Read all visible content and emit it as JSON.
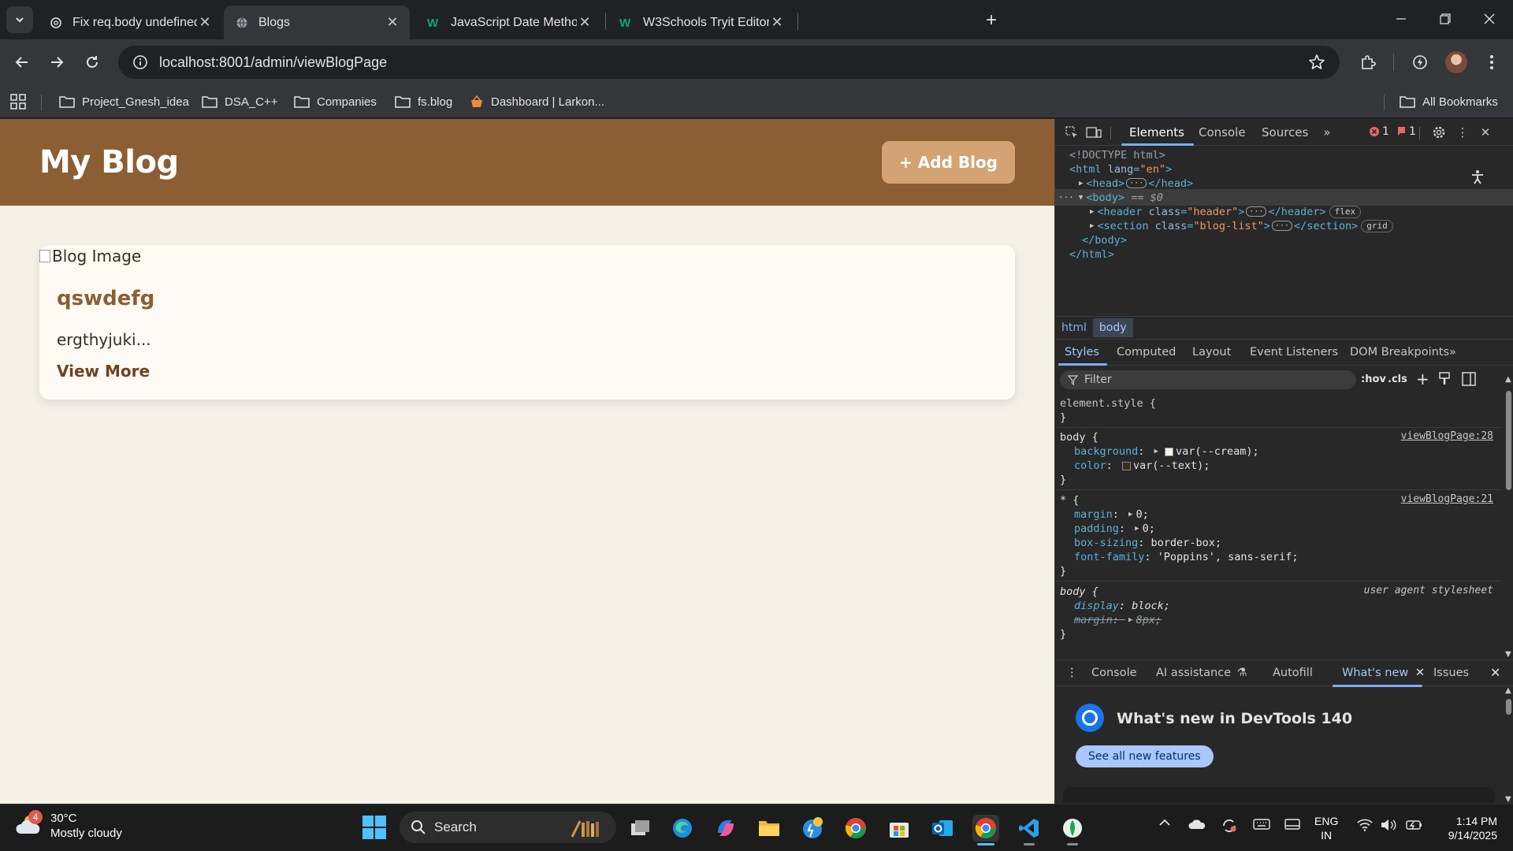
{
  "browser": {
    "tabs": [
      {
        "title": "Fix req.body undefined",
        "active": false
      },
      {
        "title": "Blogs",
        "active": true
      },
      {
        "title": "JavaScript Date Methods",
        "active": false
      },
      {
        "title": "W3Schools Tryit Editor",
        "active": false
      }
    ],
    "url": "localhost:8001/admin/viewBlogPage",
    "bookmarks": [
      "Project_Gnesh_idea",
      "DSA_C++",
      "Companies",
      "fs.blog",
      "Dashboard | Larkon..."
    ],
    "all_bookmarks": "All Bookmarks"
  },
  "page": {
    "site_title": "My Blog",
    "add_button": "+ Add Blog",
    "cards": [
      {
        "image_alt": "Blog Image",
        "title": "qswdefg",
        "excerpt": "ergthyjuki...",
        "link": "View More"
      }
    ],
    "colors": {
      "header": "#8b5e34",
      "button": "#d4a373",
      "cream": "#f5f0e8"
    }
  },
  "devtools": {
    "tabs": [
      "Elements",
      "Console",
      "Sources"
    ],
    "active_tab": "Elements",
    "errors": "1",
    "issues": "1",
    "dom": {
      "doctype": "<!DOCTYPE html>",
      "html_open_tag": "<html",
      "html_attr_name": "lang",
      "html_attr_value": "\"en\"",
      "head": "<head>",
      "head_close": "</head>",
      "body": "<body>",
      "body_marker": "== $0",
      "header_tag": "<header",
      "header_class": "\"header\"",
      "header_close": "</header>",
      "header_badge": "flex",
      "section_tag": "<section",
      "section_class": "\"blog-list\"",
      "section_close": "</section>",
      "section_badge": "grid",
      "body_close": "</body>",
      "html_close": "</html>",
      "class_attr": "class",
      "gt": ">"
    },
    "breadcrumbs": [
      "html",
      "body"
    ],
    "sub_tabs": [
      "Styles",
      "Computed",
      "Layout",
      "Event Listeners",
      "DOM Breakpoints"
    ],
    "filter_placeholder": "Filter",
    "filter_hov": ":hov",
    "filter_cls": ".cls",
    "styles": {
      "element_style": "element.style {",
      "close": "}",
      "rule1_selector": "body {",
      "rule1_source": "viewBlogPage:28",
      "rule1_props": [
        {
          "name": "background",
          "value": "var(--cream);"
        },
        {
          "name": "color",
          "value": "var(--text);"
        }
      ],
      "rule2_selector": "* {",
      "rule2_source": "viewBlogPage:21",
      "rule2_props": [
        {
          "name": "margin",
          "value": "0;"
        },
        {
          "name": "padding",
          "value": "0;"
        },
        {
          "name": "box-sizing",
          "value": "border-box;"
        },
        {
          "name": "font-family",
          "value": "'Poppins', sans-serif;"
        }
      ],
      "rule3_selector": "body {",
      "rule3_source": "user agent stylesheet",
      "rule3_props": [
        {
          "name": "display",
          "value": "block;"
        },
        {
          "name": "margin",
          "value": "8px;"
        }
      ]
    },
    "drawer_tabs": [
      "Console",
      "AI assistance",
      "Autofill",
      "What's new",
      "Issues"
    ],
    "whats_new_title": "What's new in DevTools 140",
    "whats_new_button": "See all new features"
  },
  "taskbar": {
    "weather_temp": "30°C",
    "weather_desc": "Mostly cloudy",
    "weather_badge": "4",
    "search_label": "Search",
    "lang_1": "ENG",
    "lang_2": "IN",
    "time": "1:14 PM",
    "date": "9/14/2025"
  }
}
